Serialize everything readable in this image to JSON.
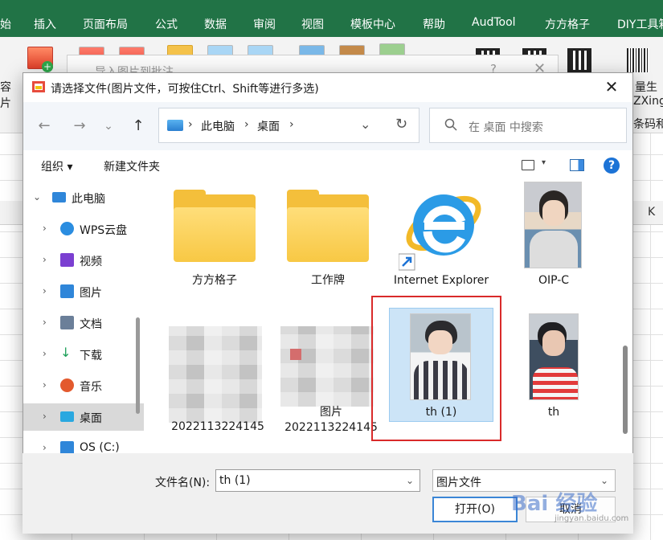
{
  "ribbon": {
    "tabs": [
      "始",
      "插入",
      "页面布局",
      "公式",
      "数据",
      "审阅",
      "视图",
      "模板中心",
      "帮助",
      "AudTool",
      "方方格子",
      "DIY工具箱"
    ],
    "left_text": [
      "容",
      "片"
    ],
    "right_text": [
      "量生",
      "ZXing",
      "条码和"
    ],
    "column_letter": "K"
  },
  "back_dialog": {
    "title": "导入图片到批注",
    "help": "?",
    "close": "✕"
  },
  "dialog": {
    "title": "请选择文件(图片文件，可按住Ctrl、Shift等进行多选)",
    "close": "✕",
    "nav": {
      "back": "←",
      "forward": "→",
      "recent": "⌄",
      "up": "↑"
    },
    "address": {
      "segments": [
        "此电脑",
        "桌面"
      ],
      "sep": "›",
      "dropdown": "⌄",
      "refresh": "↻"
    },
    "search": {
      "placeholder": "在 桌面 中搜索"
    },
    "toolbar": {
      "organize": "组织 ▾",
      "new_folder": "新建文件夹",
      "view_dd": "▾",
      "help": "?"
    },
    "sidebar": [
      {
        "label": "此电脑",
        "expanded": true,
        "icon": "pc-icon",
        "color": "#2f86d9"
      },
      {
        "label": "WPS云盘",
        "icon": "cloud-icon",
        "color": "#2b8de0"
      },
      {
        "label": "视频",
        "icon": "video-icon",
        "color": "#7b3fd1"
      },
      {
        "label": "图片",
        "icon": "pictures-icon",
        "color": "#2f86d9"
      },
      {
        "label": "文档",
        "icon": "documents-icon",
        "color": "#6b7f99"
      },
      {
        "label": "下载",
        "icon": "download-icon",
        "color": "#1ea05a"
      },
      {
        "label": "音乐",
        "icon": "music-icon",
        "color": "#e35a2e"
      },
      {
        "label": "桌面",
        "icon": "desktop-icon",
        "color": "#2aa8e0",
        "selected": true
      },
      {
        "label": "OS (C:)",
        "icon": "drive-icon",
        "color": "#2f86d9"
      }
    ],
    "files": [
      {
        "name": "方方格子",
        "kind": "folder"
      },
      {
        "name": "工作牌",
        "kind": "folder"
      },
      {
        "name": "Internet Explorer",
        "kind": "shortcut"
      },
      {
        "name": "OIP-C",
        "kind": "image"
      },
      {
        "name": "2022113224145",
        "kind": "image"
      },
      {
        "name": "图片 2022113224145",
        "kind": "image"
      },
      {
        "name": "th (1)",
        "kind": "image",
        "selected": true
      },
      {
        "name": "th",
        "kind": "image"
      }
    ],
    "filename": {
      "label": "文件名(N):",
      "value": "th (1)"
    },
    "filetype": {
      "value": "图片文件"
    },
    "buttons": {
      "open": "打开(O)",
      "cancel": "取消"
    }
  },
  "watermark": {
    "logo": "Bai 经验",
    "sub": "jingyan.baidu.com"
  }
}
